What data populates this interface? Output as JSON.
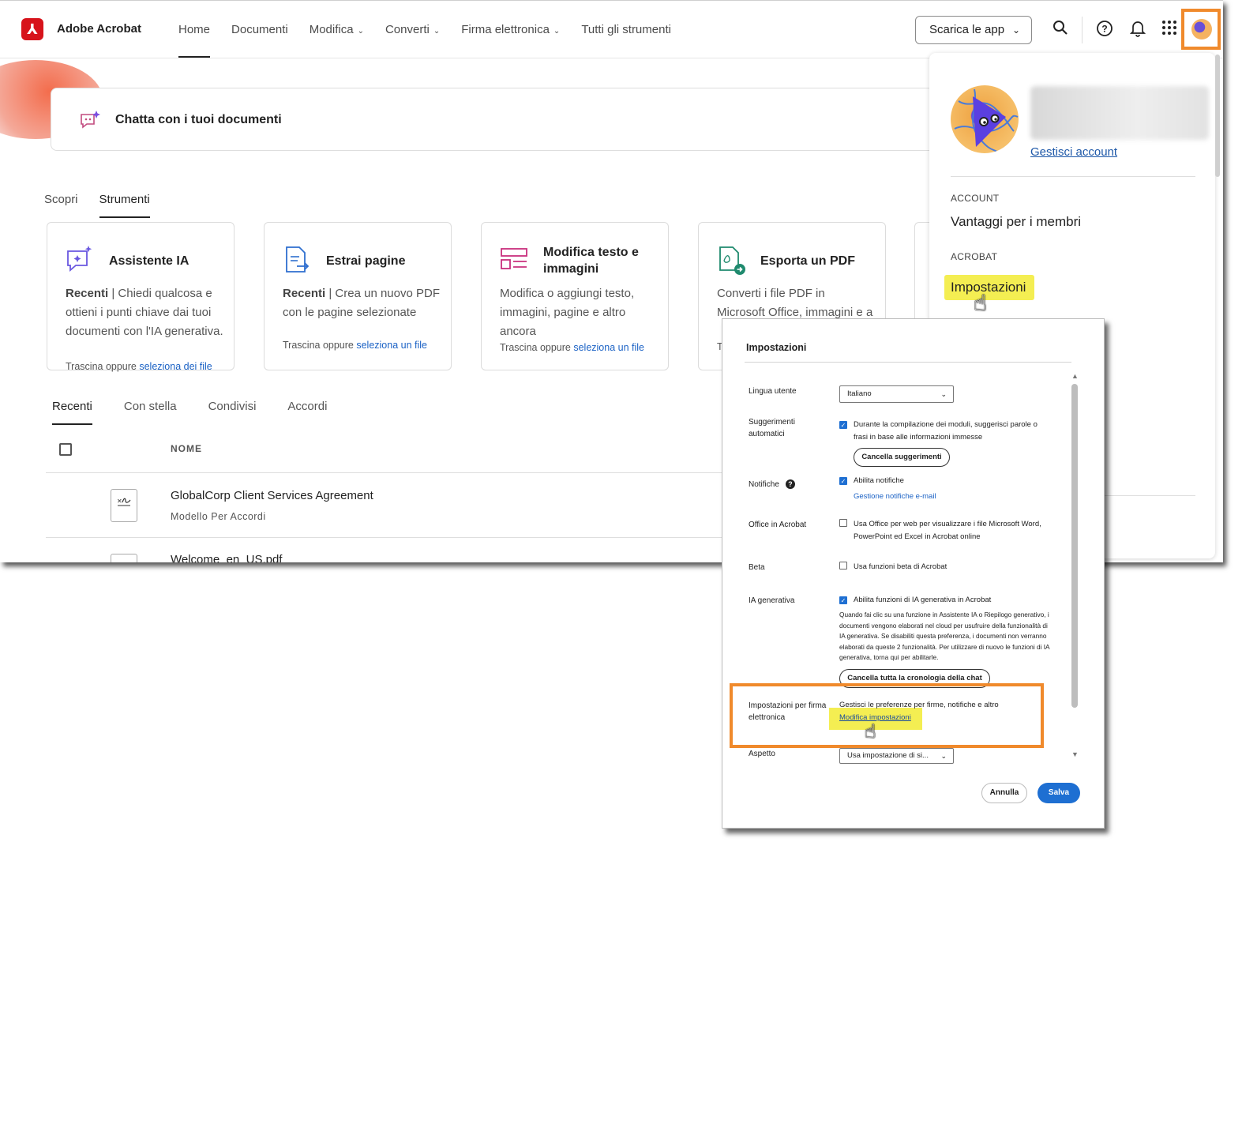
{
  "header": {
    "logo_glyph": "⅄",
    "brand": "Adobe Acrobat",
    "nav": [
      {
        "label": "Home",
        "dropdown": false
      },
      {
        "label": "Documenti",
        "dropdown": false
      },
      {
        "label": "Modifica",
        "dropdown": true
      },
      {
        "label": "Converti",
        "dropdown": true
      },
      {
        "label": "Firma elettronica",
        "dropdown": true
      },
      {
        "label": "Tutti gli strumenti",
        "dropdown": false
      }
    ],
    "get_apps": "Scarica le app",
    "icons": [
      "search-icon",
      "help-icon",
      "bell-icon",
      "apps-grid-icon",
      "avatar"
    ]
  },
  "chat": {
    "label": "Chatta con i tuoi documenti"
  },
  "tool_tabs": [
    "Scopri",
    "Strumenti"
  ],
  "tools": [
    {
      "title": "Assistente IA",
      "desc_bold": "Recenti",
      "desc": " | Chiedi qualcosa e ottieni i punti chiave dai tuoi documenti con l'IA generativa.",
      "drop_prefix": "Trascina oppure ",
      "drop_link": "seleziona dei file"
    },
    {
      "title": "Estrai pagine",
      "desc_bold": "Recenti",
      "desc": " | Crea un nuovo PDF con le pagine selezionate",
      "drop_prefix": "Trascina oppure ",
      "drop_link": "seleziona un file"
    },
    {
      "title": "Modifica testo e immagini",
      "desc_bold": "",
      "desc": "Modifica o aggiungi testo, immagini, pagine e altro ancora",
      "drop_prefix": "Trascina oppure ",
      "drop_link": "seleziona un file"
    },
    {
      "title": "Esporta un PDF",
      "desc_bold": "",
      "desc": "Converti i file PDF in Microsoft Office, immagini e a",
      "drop_prefix": "T",
      "drop_link": ""
    }
  ],
  "file_tabs": [
    "Recenti",
    "Con stella",
    "Condivisi",
    "Accordi"
  ],
  "table": {
    "col_name": "NOME",
    "rows": [
      {
        "title": "GlobalCorp Client Services Agreement",
        "sub": "Modello Per Accordi"
      },
      {
        "title": "Welcome_en_US.pdf",
        "sub": ""
      }
    ]
  },
  "account_menu": {
    "manage": "Gestisci account",
    "section_account": "ACCOUNT",
    "member_benefits": "Vantaggi per i membri",
    "section_acrobat": "ACROBAT",
    "settings": "Impostazioni"
  },
  "settings_dialog": {
    "title": "Impostazioni",
    "language": {
      "label": "Lingua utente",
      "value": "Italiano"
    },
    "autosuggest": {
      "label": "Suggerimenti automatici",
      "checked": true,
      "text": "Durante la compilazione dei moduli, suggerisci parole o frasi in base alle informazioni immesse",
      "button": "Cancella suggerimenti"
    },
    "notifications": {
      "label": "Notifiche",
      "checked": true,
      "text": "Abilita notifiche",
      "link": "Gestione notifiche e-mail"
    },
    "office": {
      "label": "Office in Acrobat",
      "checked": false,
      "text": "Usa Office per web per visualizzare i file Microsoft Word, PowerPoint ed Excel in Acrobat online"
    },
    "beta": {
      "label": "Beta",
      "checked": false,
      "text": "Usa funzioni beta di Acrobat"
    },
    "genai": {
      "label": "IA generativa",
      "checked": true,
      "text": "Abilita funzioni di IA generativa in Acrobat",
      "note": "Quando fai clic su una funzione in Assistente IA o Riepilogo generativo, i documenti vengono elaborati nel cloud per usufruire della funzionalità di IA generativa. Se disabiliti questa preferenza, i documenti non verranno elaborati da queste 2 funzionalità. Per utilizzare di nuovo le funzioni di IA generativa, torna qui per abilitarle.",
      "button": "Cancella tutta la cronologia della chat"
    },
    "esign": {
      "label": "Impostazioni per firma elettronica",
      "text": "Gestisci le preferenze per firme, notifiche e altro",
      "link": "Modifica impostazioni"
    },
    "appearance": {
      "label": "Aspetto",
      "value": "Usa impostazione di si..."
    },
    "cancel": "Annulla",
    "save": "Salva"
  },
  "colors": {
    "highlight": "#f4ee52",
    "callout": "#f08a2c",
    "link": "#1b62c5",
    "primary": "#1e6fd2",
    "brand": "#d7131b"
  }
}
